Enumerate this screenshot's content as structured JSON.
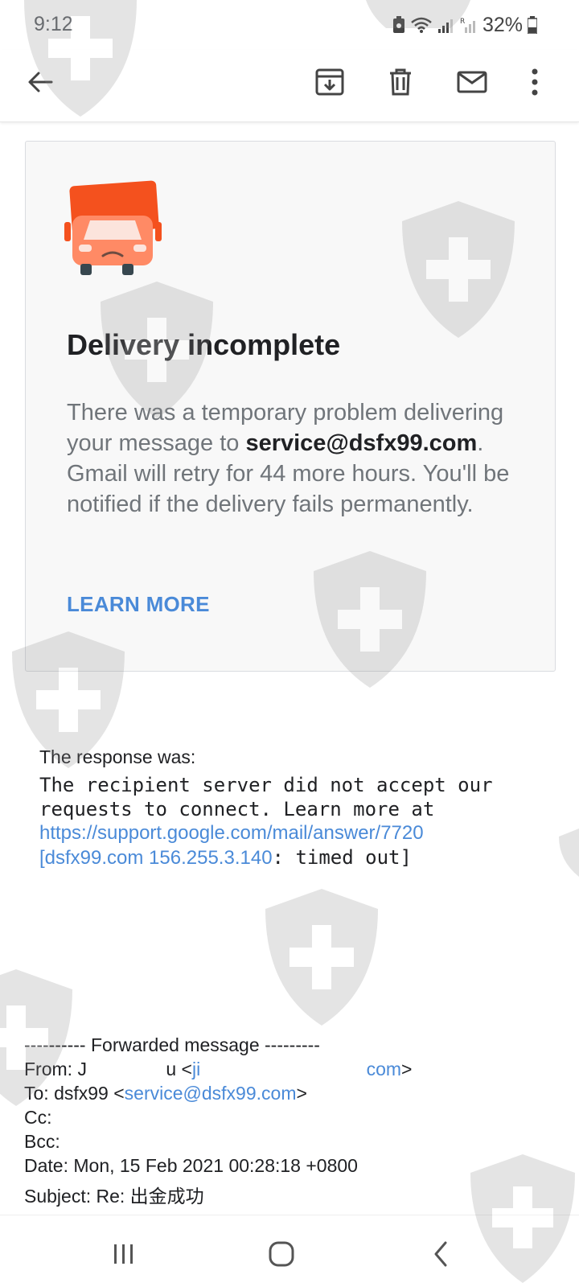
{
  "status_bar": {
    "time": "9:12",
    "battery": "32%",
    "icons": [
      "battery-saver-icon",
      "wifi-icon",
      "signal-icon",
      "roaming-signal-icon",
      "battery-icon"
    ]
  },
  "toolbar": {
    "icons": [
      "back-arrow-icon",
      "archive-icon",
      "trash-icon",
      "mail-icon",
      "more-vert-icon"
    ]
  },
  "card": {
    "icon": "truck-icon",
    "title": "Delivery incomplete",
    "body_pre": "There was a temporary problem delivering your message to ",
    "body_email": "service@dsfx99.com",
    "body_post": ". Gmail will retry for 44 more hours. You'll be notified if the delivery fails permanently.",
    "learn_more": "LEARN MORE"
  },
  "response": {
    "label": "The response was:",
    "line1": "The recipient server did not accept our",
    "line2": "requests to connect. Learn more at",
    "link": "https://support.google.com/mail/answer/7720",
    "line4_link": "[dsfx99.com  156.255.3.140",
    "line4_rest": ": timed out]"
  },
  "forwarded": {
    "header": "---------- Forwarded message ---------",
    "from_label": "From: J",
    "from_mid": "u <",
    "from_link_a": "ji",
    "from_link_b": "com",
    "from_close": ">",
    "to_label": "To: dsfx99 <",
    "to_link": "service@dsfx99.com",
    "to_close": ">",
    "cc": "Cc:",
    "bcc": "Bcc:",
    "date": "Date: Mon, 15 Feb 2021 00:28:18 +0800",
    "subject_partial": "Subject: Re: 出金成功"
  },
  "nav": {
    "icons": [
      "recent-apps-icon",
      "home-icon",
      "nav-back-icon"
    ]
  },
  "colors": {
    "link": "#4a8ad8",
    "truck_cab": "#f4511e",
    "truck_body": "#ff8a65"
  }
}
